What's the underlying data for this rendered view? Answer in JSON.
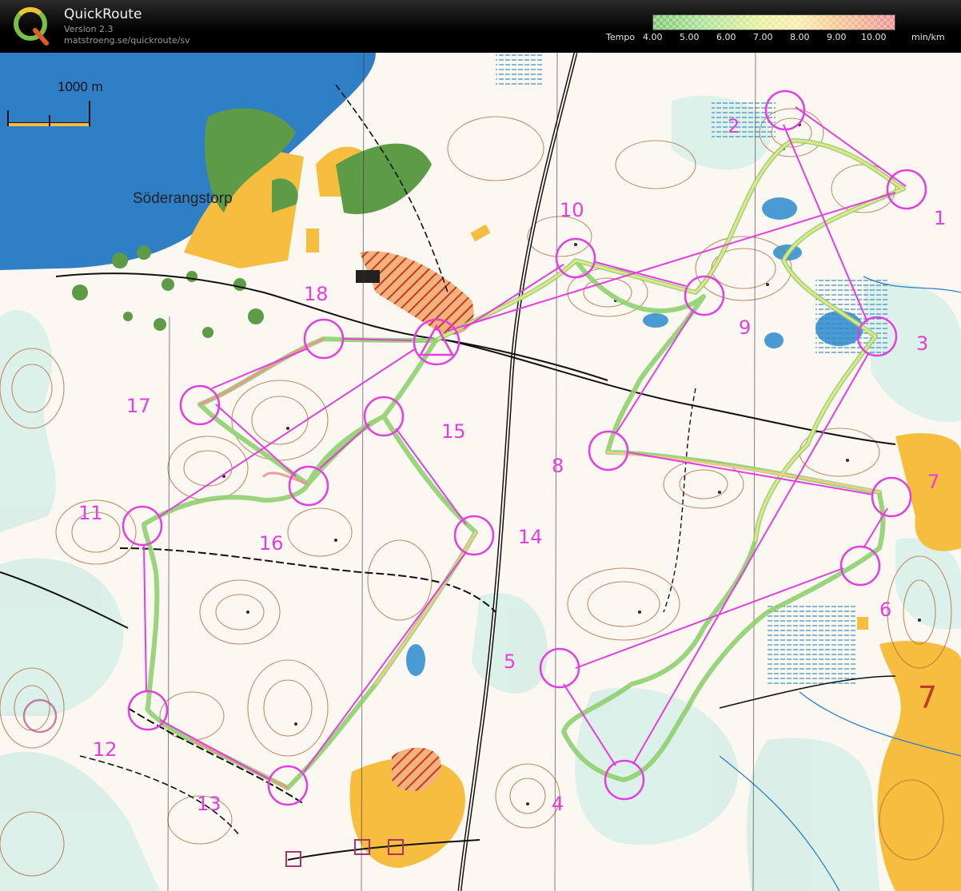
{
  "app": {
    "title": "QuickRoute",
    "version": "Version 2.3",
    "url": "matstroeng.se/quickroute/sv"
  },
  "legend": {
    "label": "Tempo",
    "ticks": [
      "4.00",
      "5.00",
      "6.00",
      "7.00",
      "8.00",
      "9.00",
      "10.00"
    ],
    "unit": "min/km",
    "gradient_colors": [
      "#7dc66f",
      "#aee39a",
      "#e6ef9a",
      "#f9ecaf",
      "#f6c98f",
      "#f19191"
    ]
  },
  "map": {
    "scale_label": "1000 m",
    "place_label": "Söderangstorp",
    "control_numbers": [
      "1",
      "2",
      "3",
      "4",
      "5",
      "6",
      "7",
      "8",
      "9",
      "10",
      "11",
      "12",
      "13",
      "14",
      "15",
      "16",
      "17",
      "18"
    ],
    "colors": {
      "course": "#e43ee0",
      "water": "#2f7fc6",
      "field": "#f6bd3f",
      "forest_green": "#5d9b46",
      "contour": "#b06a3a"
    }
  }
}
